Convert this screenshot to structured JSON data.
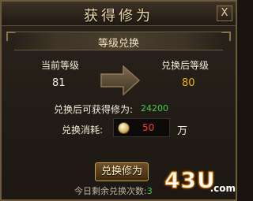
{
  "window": {
    "title": "获得修为",
    "close_label": "X"
  },
  "banner": {
    "title": "等级兑换"
  },
  "levels": {
    "current_label": "当前等级",
    "current_value": "81",
    "after_label": "兑换后等级",
    "after_value": "80"
  },
  "gain": {
    "label": "兑换后可获得修为:",
    "value": "24200"
  },
  "cost": {
    "label": "兑换消耗:",
    "value": "50",
    "unit": "万"
  },
  "action": {
    "button_label": "兑换修为"
  },
  "remaining": {
    "label": "今日剩余兑换次数:",
    "value": "3"
  },
  "watermark": {
    "brand": "43U",
    "suffix": ".com"
  },
  "colors": {
    "accent_gold": "#e9d6a8",
    "green": "#3fd24a",
    "red": "#ff3b30",
    "orange_value": "#f0b400"
  }
}
